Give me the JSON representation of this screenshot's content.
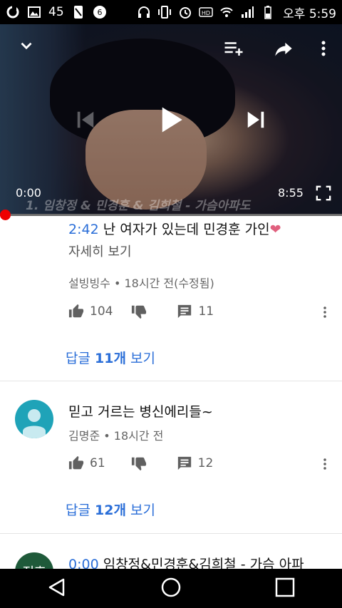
{
  "status_bar": {
    "signal_count": "45",
    "clock": "오후 5:59",
    "icons": [
      "app-o-icon",
      "image-icon",
      "screenshot-icon",
      "notification-icon",
      "headset-icon",
      "vibrate-icon",
      "alarm-icon",
      "hd-icon",
      "wifi-icon",
      "signal-icon",
      "battery-icon"
    ]
  },
  "player": {
    "current_time": "0:00",
    "duration": "8:55",
    "caption": "1. 임창정 & 민경훈 & 김희철 - 가슴아파도",
    "progress_fraction": 0,
    "accent_color": "#ee0000"
  },
  "comments": [
    {
      "timestamp": "2:42",
      "text": " 난 여자가 있는데 민경훈 가인",
      "emoji": "❤",
      "more_label": "자세히 보기",
      "meta": "설빙빙수 • 18시간 전(수정됨)",
      "likes": "104",
      "reply_count": "11",
      "replies_prefix": "답글 ",
      "replies_count_label": "11개",
      "replies_suffix": " 보기"
    },
    {
      "text": "믿고 거르는 병신에리들~",
      "meta": "김명준 • 18시간 전",
      "likes": "61",
      "reply_count": "12",
      "replies_prefix": "답글 ",
      "replies_count_label": "12개",
      "replies_suffix": " 보기",
      "avatar_color": "#1fa3b8"
    },
    {
      "timestamp": "0:00",
      "text": " 임창정&민경훈&김희철 - 가슴 아파",
      "avatar_text": "정후",
      "avatar_color": "#1f5a3a"
    }
  ],
  "link_color": "#2a6ed8"
}
